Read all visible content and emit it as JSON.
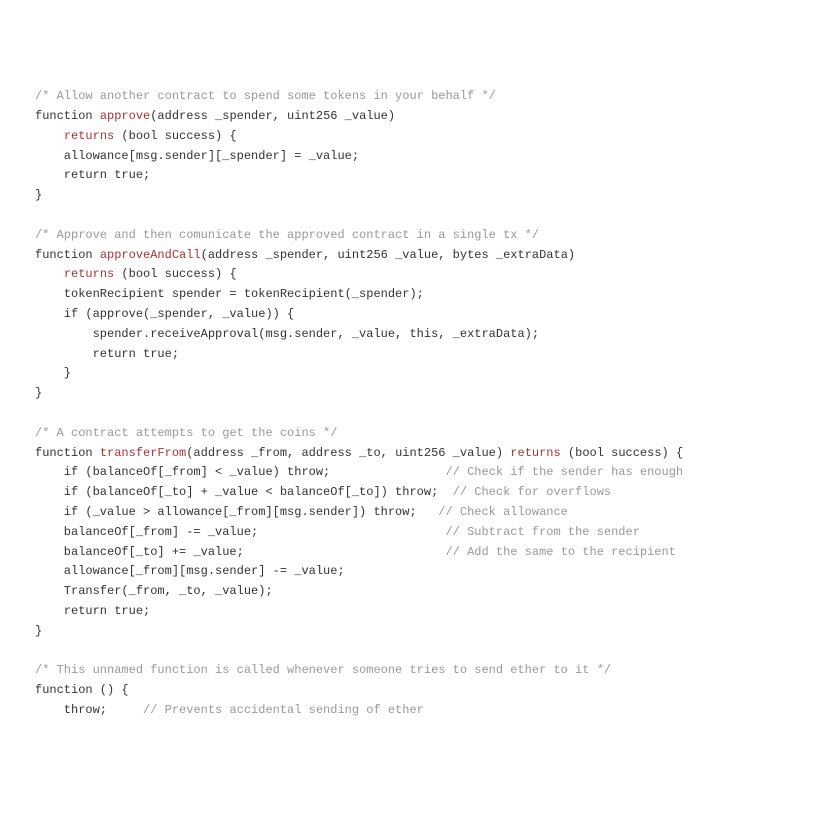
{
  "code": {
    "lines": [
      {
        "type": "comment",
        "text": "/* Allow another contract to spend some tokens in your behalf */"
      },
      {
        "type": "func-decl",
        "prefix": "function ",
        "name": "approve",
        "suffix": "(address _spender, uint256 _value)"
      },
      {
        "type": "returns-line",
        "indent": "    ",
        "kw": "returns",
        "suffix": " (bool success) {"
      },
      {
        "type": "plain",
        "text": "    allowance[msg.sender][_spender] = _value;"
      },
      {
        "type": "plain",
        "text": "    return true;"
      },
      {
        "type": "plain",
        "text": "}"
      },
      {
        "type": "blank",
        "text": ""
      },
      {
        "type": "comment",
        "text": "/* Approve and then comunicate the approved contract in a single tx */"
      },
      {
        "type": "func-decl",
        "prefix": "function ",
        "name": "approveAndCall",
        "suffix": "(address _spender, uint256 _value, bytes _extraData)"
      },
      {
        "type": "returns-line",
        "indent": "    ",
        "kw": "returns",
        "suffix": " (bool success) {"
      },
      {
        "type": "plain",
        "text": "    tokenRecipient spender = tokenRecipient(_spender);"
      },
      {
        "type": "plain",
        "text": "    if (approve(_spender, _value)) {"
      },
      {
        "type": "plain",
        "text": "        spender.receiveApproval(msg.sender, _value, this, _extraData);"
      },
      {
        "type": "plain",
        "text": "        return true;"
      },
      {
        "type": "plain",
        "text": "    }"
      },
      {
        "type": "plain",
        "text": "}"
      },
      {
        "type": "blank",
        "text": ""
      },
      {
        "type": "comment",
        "text": "/* A contract attempts to get the coins */"
      },
      {
        "type": "func-decl-returns",
        "prefix": "function ",
        "name": "transferFrom",
        "mid": "(address _from, address _to, uint256 _value) ",
        "kw": "returns",
        "suffix": " (bool success) {"
      },
      {
        "type": "plain-comment",
        "code": "    if (balanceOf[_from] < _value) throw;                ",
        "comment": "// Check if the sender has enough"
      },
      {
        "type": "plain-comment",
        "code": "    if (balanceOf[_to] + _value < balanceOf[_to]) throw;  ",
        "comment": "// Check for overflows"
      },
      {
        "type": "plain-comment",
        "code": "    if (_value > allowance[_from][msg.sender]) throw;   ",
        "comment": "// Check allowance"
      },
      {
        "type": "plain-comment",
        "code": "    balanceOf[_from] -= _value;                          ",
        "comment": "// Subtract from the sender"
      },
      {
        "type": "plain-comment",
        "code": "    balanceOf[_to] += _value;                            ",
        "comment": "// Add the same to the recipient"
      },
      {
        "type": "plain",
        "text": "    allowance[_from][msg.sender] -= _value;"
      },
      {
        "type": "plain",
        "text": "    Transfer(_from, _to, _value);"
      },
      {
        "type": "plain",
        "text": "    return true;"
      },
      {
        "type": "plain",
        "text": "}"
      },
      {
        "type": "blank",
        "text": ""
      },
      {
        "type": "comment",
        "text": "/* This unnamed function is called whenever someone tries to send ether to it */"
      },
      {
        "type": "plain",
        "text": "function () {"
      },
      {
        "type": "plain-comment",
        "code": "    throw;     ",
        "comment": "// Prevents accidental sending of ether"
      }
    ]
  }
}
